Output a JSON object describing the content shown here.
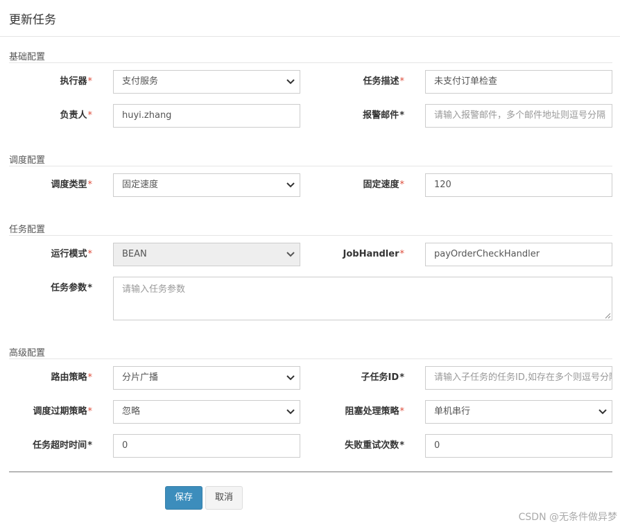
{
  "modal": {
    "title": "更新任务"
  },
  "sections": {
    "basic": "基础配置",
    "schedule": "调度配置",
    "task": "任务配置",
    "advanced": "高级配置"
  },
  "required_mark": "*",
  "fields": {
    "executor": {
      "label": "执行器",
      "value": "支付服务"
    },
    "job_desc": {
      "label": "任务描述",
      "value": "未支付订单检查"
    },
    "owner": {
      "label": "负责人",
      "value": "huyi.zhang"
    },
    "alarm_email": {
      "label": "报警邮件",
      "value": "",
      "placeholder": "请输入报警邮件，多个邮件地址则逗号分隔"
    },
    "schedule_type": {
      "label": "调度类型",
      "value": "固定速度"
    },
    "fixed_rate": {
      "label": "固定速度",
      "value": "120"
    },
    "run_mode": {
      "label": "运行模式",
      "value": "BEAN"
    },
    "job_handler": {
      "label": "JobHandler",
      "value": "payOrderCheckHandler"
    },
    "job_param": {
      "label": "任务参数",
      "value": "",
      "placeholder": "请输入任务参数"
    },
    "route_strategy": {
      "label": "路由策略",
      "value": "分片广播"
    },
    "child_job_id": {
      "label": "子任务ID",
      "value": "",
      "placeholder": "请输入子任务的任务ID,如存在多个则逗号分隔"
    },
    "misfire_strategy": {
      "label": "调度过期策略",
      "value": "忽略"
    },
    "block_strategy": {
      "label": "阻塞处理策略",
      "value": "单机串行"
    },
    "timeout": {
      "label": "任务超时时间",
      "value": "0"
    },
    "fail_retry": {
      "label": "失败重试次数",
      "value": "0"
    }
  },
  "buttons": {
    "save": "保存",
    "cancel": "取消"
  },
  "watermark": "CSDN @无条件做异梦",
  "colors": {
    "primary": "#3c8dbc",
    "required": "#dd4b39",
    "disabled_bg": "#eeeeee"
  }
}
